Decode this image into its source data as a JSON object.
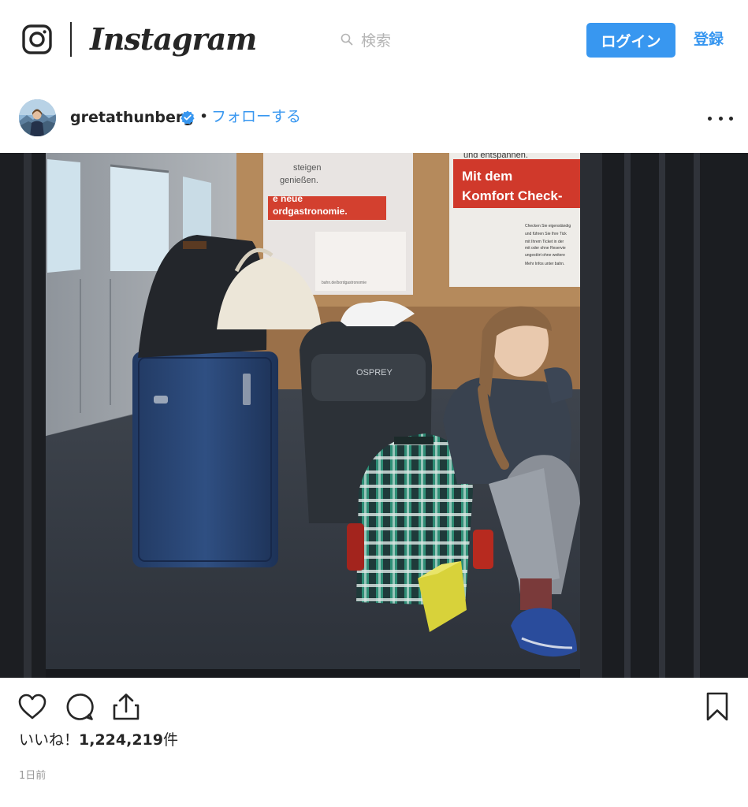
{
  "header": {
    "brand": "Instagram",
    "search_placeholder": "検索",
    "login_label": "ログイン",
    "register_label": "登録"
  },
  "post": {
    "username": "gretathunberg",
    "separator": "•",
    "follow_label": "フォローする",
    "photo_signs": {
      "left_line1": "steigen",
      "left_line2": "genießen.",
      "left_line3": "e neue",
      "left_line4": "ordgastronomie.",
      "left_small": "bahn.de/bordgastronomie",
      "right_top": "und entspannen.",
      "right_line1": "Mit dem",
      "right_line2": "Komfort Check-",
      "right_small1": "Checken Sie eigenständig",
      "right_small2": "und führen Sie Ihre Tick",
      "right_small3": "mit Ihrem Ticket in der",
      "right_small4": "mit oder ohne Reservie",
      "right_small5": "ungestört ohne weitere",
      "right_small6": "Mehr Infos unter bahn.",
      "backpack_brand": "OSPREY"
    },
    "likes_prefix": "いいね！",
    "likes_count": "1,224,219",
    "likes_suffix": "件",
    "timestamp": "1日前"
  },
  "colors": {
    "accent": "#3897f0",
    "text": "#262626",
    "muted": "#999999"
  },
  "icons": [
    "instagram-glyph-icon",
    "search-icon",
    "verified-badge-icon",
    "more-options-icon",
    "heart-icon",
    "comment-icon",
    "share-icon",
    "bookmark-icon"
  ]
}
